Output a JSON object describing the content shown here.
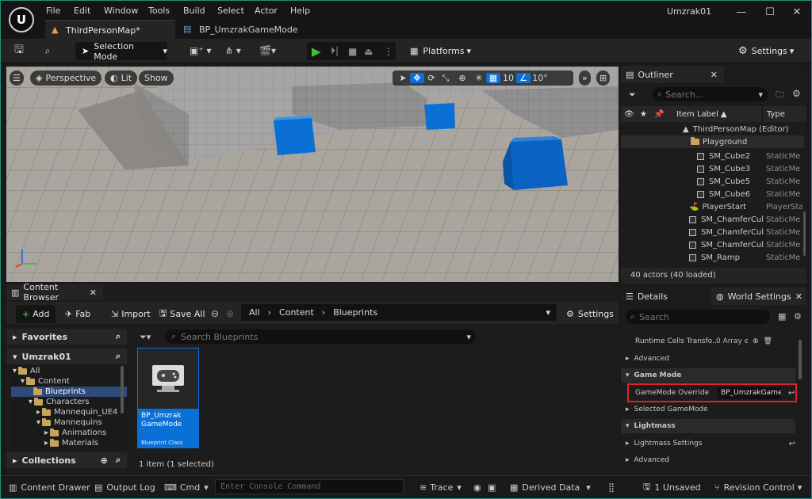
{
  "menu": [
    "File",
    "Edit",
    "Window",
    "Tools",
    "Build",
    "Select",
    "Actor",
    "Help"
  ],
  "window_title": "Umzrak01",
  "tabs": {
    "level": "ThirdPersonMap*",
    "blueprint": "BP_UmzrakGameMode"
  },
  "toolbar": {
    "selection_mode": "Selection Mode",
    "platforms": "Platforms",
    "settings": "Settings"
  },
  "viewport": {
    "perspective": "Perspective",
    "lit": "Lit",
    "show": "Show",
    "grid_snap": "10",
    "rot_snap": "10°"
  },
  "outliner": {
    "title": "Outliner",
    "search_placeholder": "Search...",
    "col_label": "Item Label",
    "col_type": "Type",
    "rows": [
      {
        "label": "ThirdPersonMap (Editor)",
        "type": ""
      },
      {
        "label": "Playground",
        "type": ""
      },
      {
        "label": "SM_Cube2",
        "type": "StaticMe"
      },
      {
        "label": "SM_Cube3",
        "type": "StaticMe"
      },
      {
        "label": "SM_Cube5",
        "type": "StaticMe"
      },
      {
        "label": "SM_Cube6",
        "type": "StaticMe"
      },
      {
        "label": "PlayerStart",
        "type": "PlayerSta"
      },
      {
        "label": "SM_ChamferCul",
        "type": "StaticMe"
      },
      {
        "label": "SM_ChamferCul",
        "type": "StaticMe"
      },
      {
        "label": "SM_ChamferCul",
        "type": "StaticMe"
      },
      {
        "label": "SM_Ramp",
        "type": "StaticMe"
      }
    ],
    "footer": "40 actors (40 loaded)"
  },
  "content_browser": {
    "title": "Content Browser",
    "add": "Add",
    "fab": "Fab",
    "import": "Import",
    "save_all": "Save All",
    "path": [
      "All",
      "Content",
      "Blueprints"
    ],
    "settings": "Settings",
    "favorites": "Favorites",
    "project": "Umzrak01",
    "tree": [
      "All",
      "Content",
      "Blueprints",
      "Characters",
      "Mannequin_UE4",
      "Mannequins",
      "Animations",
      "Materials"
    ],
    "collections": "Collections",
    "search_placeholder": "Search Blueprints",
    "asset_name": "BP_Umzrak GameMode",
    "asset_class": "Blueprint Class",
    "item_count": "1 item (1 selected)"
  },
  "details": {
    "tab_details": "Details",
    "tab_world": "World Settings",
    "search_placeholder": "Search",
    "runtime_cells": "Runtime Cells Transfo...",
    "array_elements": "0 Array ele",
    "advanced1": "Advanced",
    "game_mode_header": "Game Mode",
    "gamemode_override_label": "GameMode Override",
    "gamemode_override_value": "BP_UmzrakGameM",
    "selected_gamemode": "Selected GameMode",
    "lightmass_header": "Lightmass",
    "lightmass_settings": "Lightmass Settings",
    "advanced2": "Advanced"
  },
  "statusbar": {
    "content_drawer": "Content Drawer",
    "output_log": "Output Log",
    "cmd": "Cmd",
    "console_placeholder": "Enter Console Command",
    "trace": "Trace",
    "derived_data": "Derived Data",
    "unsaved": "1 Unsaved",
    "revision_control": "Revision Control"
  },
  "colors": {
    "accent_blue": "#0a70d6",
    "highlight_red": "#e0202a",
    "play_green": "#3fbf3f",
    "folder": "#c7a55a"
  }
}
